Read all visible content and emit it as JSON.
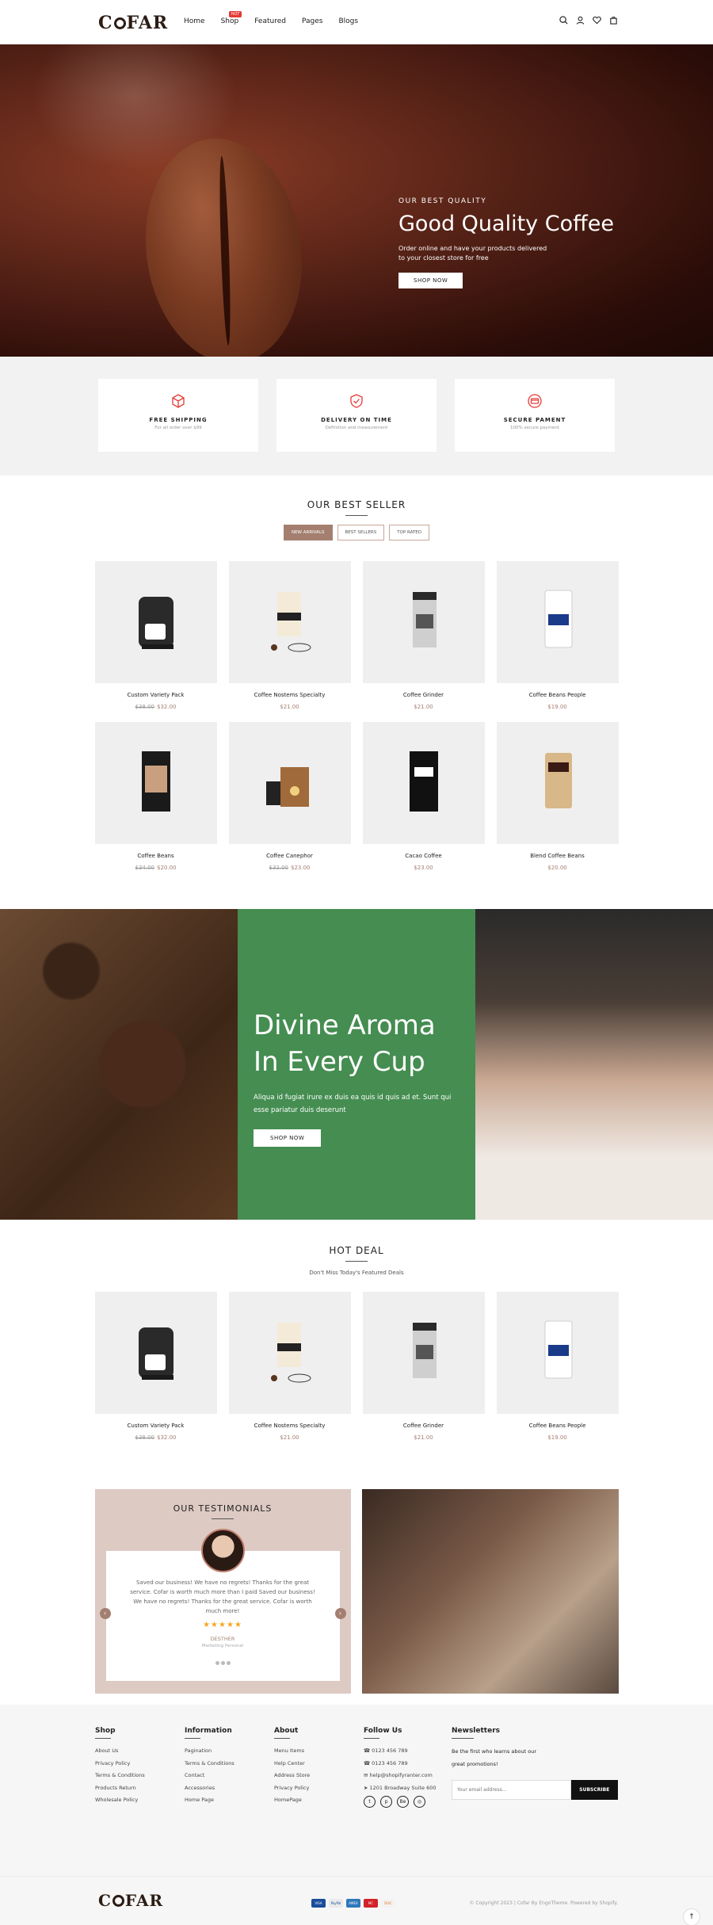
{
  "header": {
    "logo": "COFAR",
    "nav": [
      "Home",
      "Shop",
      "Featured",
      "Pages",
      "Blogs"
    ],
    "hot_badge": "HOT"
  },
  "hero": {
    "subtitle": "OUR BEST QUALITY",
    "title": "Good Quality Coffee",
    "text": "Order online and have your products delivered to your closest store for free",
    "button": "SHOP NOW"
  },
  "features": [
    {
      "title": "FREE SHIPPING",
      "text": "For all order over $99",
      "icon": "box-icon"
    },
    {
      "title": "DELIVERY ON TIME",
      "text": "Definition and measurement",
      "icon": "shield-icon"
    },
    {
      "title": "SECURE PAMENT",
      "text": "100% secure payment",
      "icon": "card-icon"
    }
  ],
  "bestseller": {
    "title": "OUR BEST SELLER",
    "tabs": [
      "NEW ARRIVALS",
      "BEST SELLERS",
      "TOP RATED"
    ],
    "products": [
      {
        "name": "Custom Variety Pack",
        "old": "$38.00",
        "price": "$32.00"
      },
      {
        "name": "Coffee Nostems Specialty",
        "old": "",
        "price": "$21.00"
      },
      {
        "name": "Coffee Grinder",
        "old": "",
        "price": "$21.00"
      },
      {
        "name": "Coffee Beans People",
        "old": "",
        "price": "$19.00"
      },
      {
        "name": "Coffee Beans",
        "old": "$34.00",
        "price": "$20.00"
      },
      {
        "name": "Coffee Canephor",
        "old": "$32.00",
        "price": "$23.00"
      },
      {
        "name": "Cacao Coffee",
        "old": "",
        "price": "$23.00"
      },
      {
        "name": "Blend Coffee Beans",
        "old": "",
        "price": "$20.00"
      }
    ]
  },
  "banner": {
    "line1": "Divine Aroma",
    "line2": "In Every Cup",
    "text": "Aliqua id fugiat irure ex duis ea quis id quis ad et. Sunt qui esse pariatur duis deserunt",
    "button": "SHOP NOW"
  },
  "hotdeal": {
    "title": "HOT DEAL",
    "subtitle": "Don't Miss Today's Featured Deals",
    "products": [
      {
        "name": "Custom Variety Pack",
        "old": "$38.00",
        "price": "$32.00"
      },
      {
        "name": "Coffee Nostems Specialty",
        "old": "",
        "price": "$21.00"
      },
      {
        "name": "Coffee Grinder",
        "old": "",
        "price": "$21.00"
      },
      {
        "name": "Coffee Beans People",
        "old": "",
        "price": "$19.00"
      }
    ]
  },
  "testimonial": {
    "title": "OUR TESTIMONIALS",
    "text": "Saved our business! We have no regrets! Thanks for the great service. Cofar is worth much more than I paid Saved our business! We have no regrets! Thanks for the great service. Cofar is worth much more!",
    "stars": "★★★★★",
    "name": "DESTHER",
    "role": "Marketing Personal"
  },
  "footer": {
    "cols": [
      {
        "title": "Shop",
        "links": [
          "About Us",
          "Privacy Policy",
          "Terms & Conditions",
          "Products Return",
          "Wholesale Policy"
        ]
      },
      {
        "title": "Information",
        "links": [
          "Pagination",
          "Terms & Conditions",
          "Contact",
          "Accessories",
          "Home Page"
        ]
      },
      {
        "title": "About",
        "links": [
          "Menu Items",
          "Help Center",
          "Address Store",
          "Privacy Policy",
          "HomePage"
        ]
      },
      {
        "title": "Follow Us",
        "links": [
          "0123 456 789",
          "0123 456 789",
          "help@shopifyranter.com",
          "1201 Broadway Suite 600"
        ]
      }
    ],
    "news_title": "Newsletters",
    "news_text": "Be the first who learns about our great promotions!",
    "news_placeholder": "Your email address...",
    "news_button": "SUBSCRIBE",
    "copyright": "© Copyright 2023 | Cofar By EngoTheme. Powered by Shopify.",
    "payments": [
      "VISA",
      "PayPal",
      "AMEX",
      "MC",
      "DISC"
    ]
  }
}
